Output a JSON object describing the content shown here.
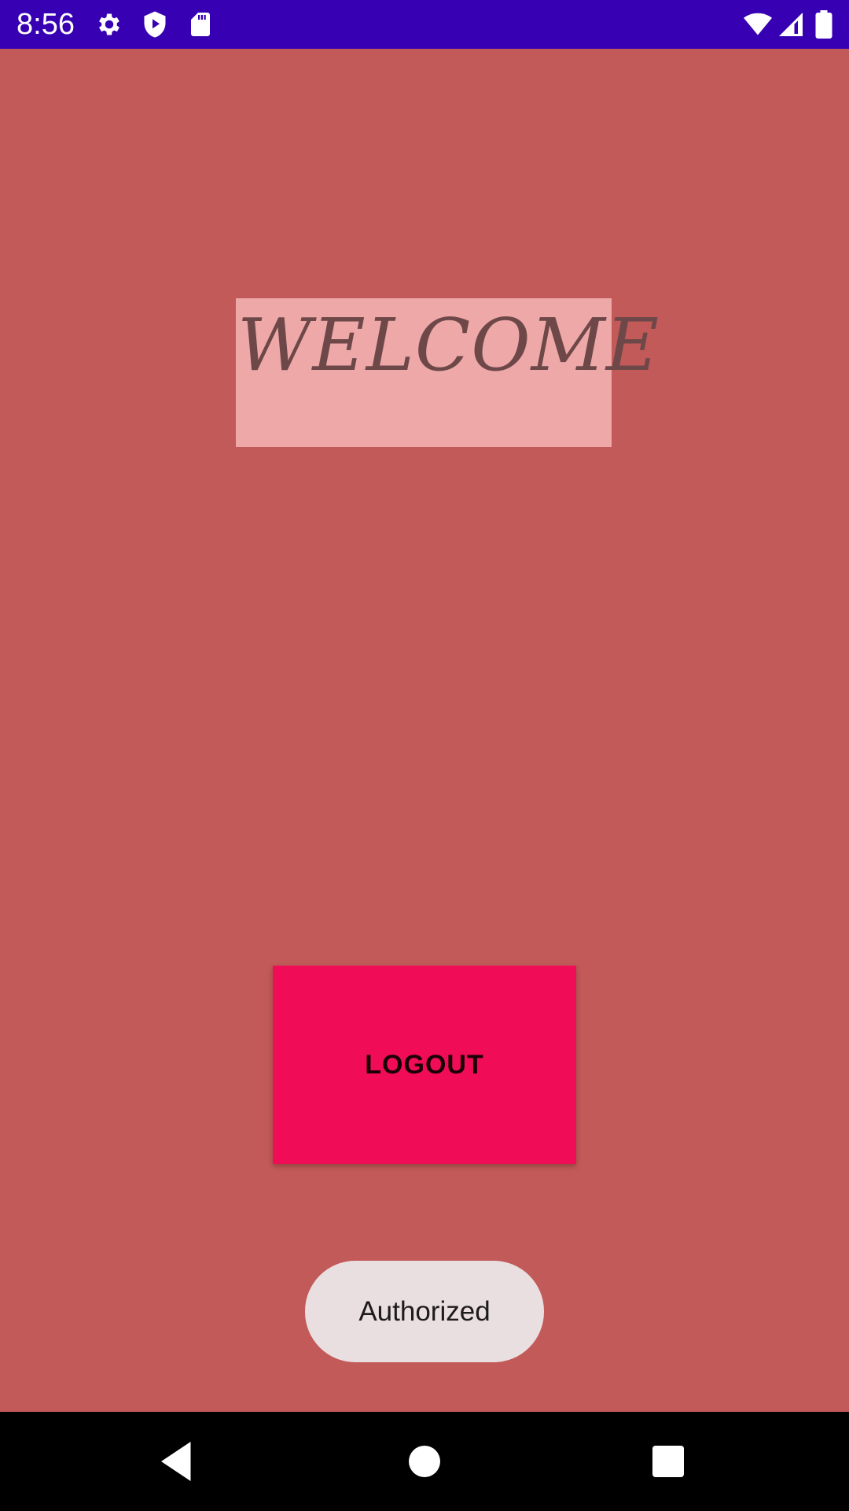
{
  "status_bar": {
    "time": "8:56",
    "background": "#3700B3",
    "icons": [
      "settings-icon",
      "shield-play-icon",
      "sd-card-icon",
      "wifi-icon",
      "cellular-signal-icon",
      "battery-icon"
    ]
  },
  "welcome": {
    "text": "WELCOME",
    "background": "#EEA8A8",
    "text_color": "#6E4848"
  },
  "logout": {
    "label": "LOGOUT",
    "background": "#F00C57"
  },
  "toast": {
    "text": "Authorized",
    "background": "#EADFE0"
  },
  "page": {
    "background": "#C15A58"
  },
  "nav_bar": {
    "buttons": [
      "back-icon",
      "home-icon",
      "recents-icon"
    ]
  }
}
